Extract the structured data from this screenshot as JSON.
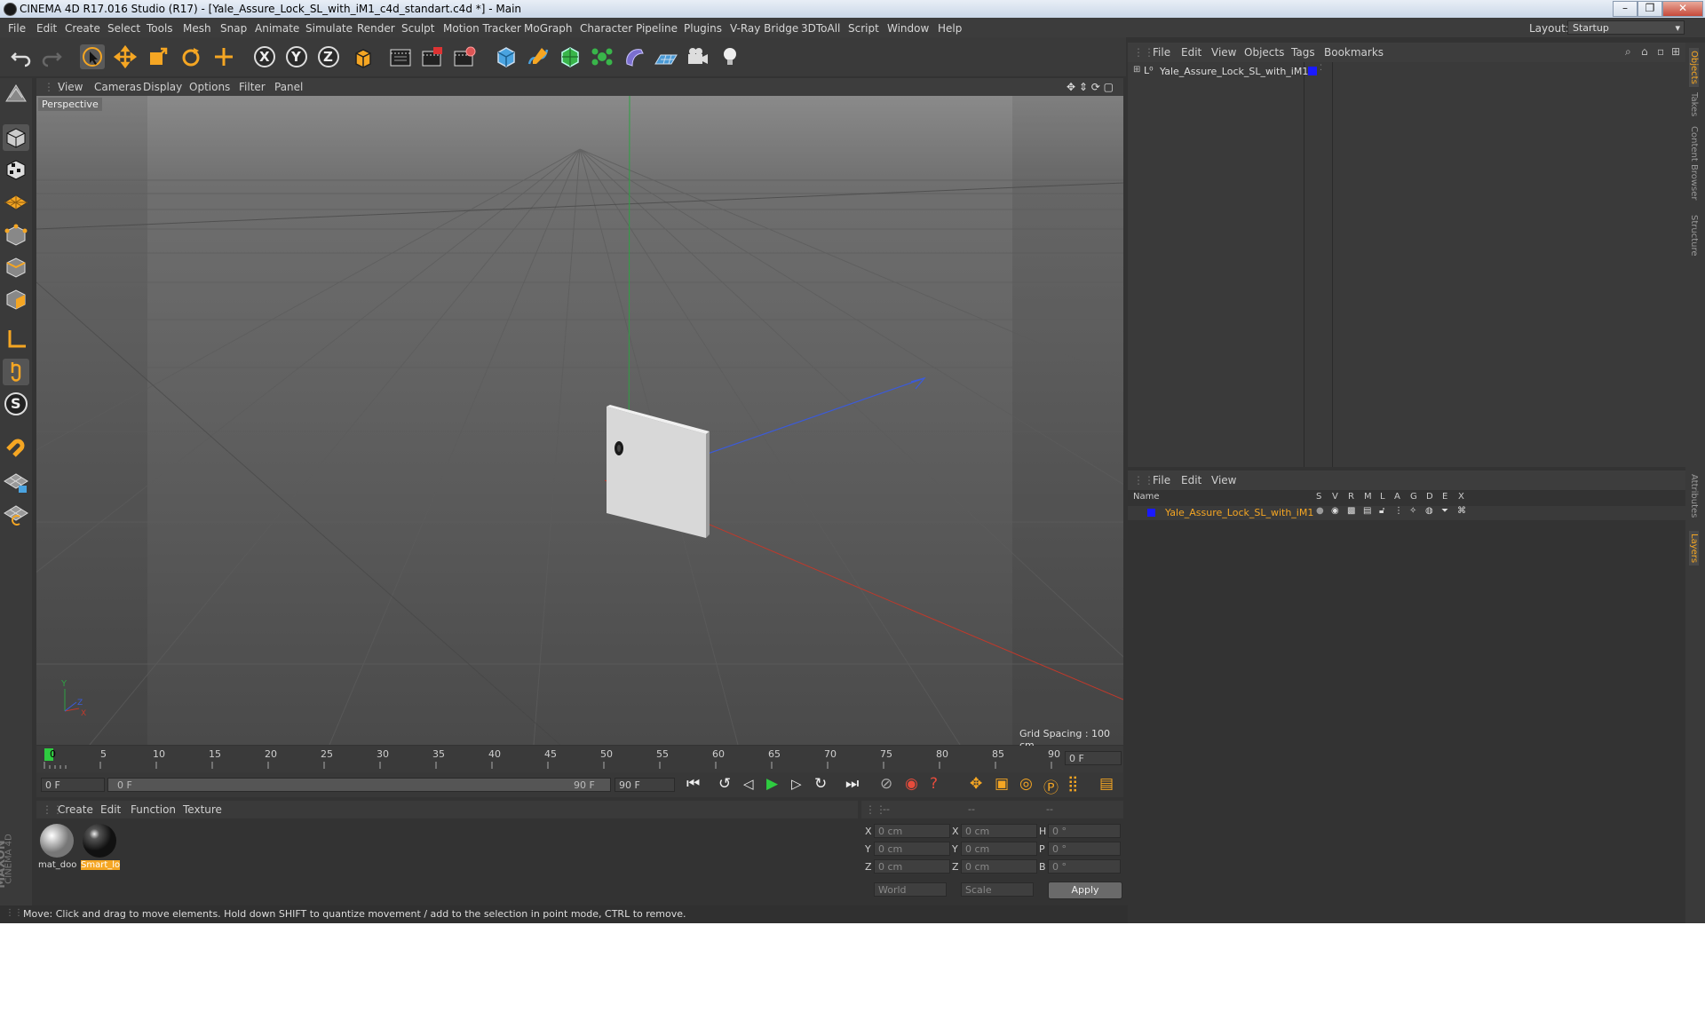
{
  "window": {
    "title": "CINEMA 4D R17.016 Studio (R17) - [Yale_Assure_Lock_SL_with_iM1_c4d_standart.c4d *] - Main",
    "controls": [
      "–",
      "❐",
      "✕"
    ]
  },
  "menubar": {
    "items": [
      "File",
      "Edit",
      "Create",
      "Select",
      "Tools",
      "Mesh",
      "Snap",
      "Animate",
      "Simulate",
      "Render",
      "Sculpt",
      "Motion Tracker",
      "MoGraph",
      "Character",
      "Pipeline",
      "Plugins",
      "V-Ray Bridge",
      "3DToAll",
      "Script",
      "Window",
      "Help"
    ],
    "layout_label": "Layout:",
    "layout_value": "Startup"
  },
  "toolbar": {
    "icons": [
      "undo-icon",
      "redo-icon",
      "live-selection-icon",
      "move-icon",
      "scale-icon",
      "rotate-icon",
      "recent-tools-icon",
      "x-axis-icon",
      "y-axis-icon",
      "z-axis-icon",
      "coordinate-system-icon",
      "render-view-icon",
      "render-picture-viewer-icon",
      "render-settings-icon",
      "cube-primitive-icon",
      "spline-pen-icon",
      "subdivision-surface-icon",
      "cloner-icon",
      "deformer-icon",
      "floor-icon",
      "camera-icon",
      "light-icon"
    ],
    "axis_labels": [
      "X",
      "Y",
      "Z"
    ]
  },
  "left_toolbar": {
    "icons": [
      "make-editable-icon",
      "model-mode-icon",
      "texture-mode-icon",
      "workplane-icon",
      "points-mode-icon",
      "edges-mode-icon",
      "polygons-mode-icon",
      "axis-mode-icon",
      "tweak-icon",
      "snap-s-icon",
      "magnet-icon",
      "workplane-lock-icon",
      "grid-snap-icon"
    ],
    "snap_label": "S"
  },
  "viewport": {
    "menu": [
      "View",
      "Cameras",
      "Display",
      "Options",
      "Filter",
      "Panel"
    ],
    "label": "Perspective",
    "grid_spacing": "Grid Spacing : 100 cm",
    "axis_labels": {
      "y": "Y",
      "z": "Z",
      "x": "X"
    }
  },
  "timeline": {
    "ticks": [
      "0",
      "5",
      "10",
      "15",
      "20",
      "25",
      "30",
      "35",
      "40",
      "45",
      "50",
      "55",
      "60",
      "65",
      "70",
      "75",
      "80",
      "85",
      "90"
    ],
    "current_frame": "0 F",
    "start_field": "0 F",
    "range_start": "0 F",
    "range_end": "90 F",
    "end_field": "90 F"
  },
  "materials": {
    "menu": [
      "Create",
      "Edit",
      "Function",
      "Texture"
    ],
    "items": [
      {
        "name": "mat_doo"
      },
      {
        "name": "Smart_lo"
      }
    ],
    "brand_top": "MAXON",
    "brand_bottom": "CINEMA 4D"
  },
  "coordinates": {
    "headers": [
      "--",
      "--",
      "--"
    ],
    "rows": [
      {
        "a": "X",
        "av": "0 cm",
        "b": "X",
        "bv": "0 cm",
        "c": "H",
        "cv": "0 °"
      },
      {
        "a": "Y",
        "av": "0 cm",
        "b": "Y",
        "bv": "0 cm",
        "c": "P",
        "cv": "0 °"
      },
      {
        "a": "Z",
        "av": "0 cm",
        "b": "Z",
        "bv": "0 cm",
        "c": "B",
        "cv": "0 °"
      }
    ],
    "mode1": "World",
    "mode2": "Scale",
    "apply": "Apply"
  },
  "object_manager": {
    "menu": [
      "File",
      "Edit",
      "View",
      "Objects",
      "Tags",
      "Bookmarks"
    ],
    "object_name": "Yale_Assure_Lock_SL_with_iM1",
    "layer_color": "#1a1aff"
  },
  "layer_manager": {
    "menu": [
      "File",
      "Edit",
      "View"
    ],
    "columns": [
      "Name",
      "S",
      "V",
      "R",
      "M",
      "L",
      "A",
      "G",
      "D",
      "E",
      "X"
    ],
    "layer_name": "Yale_Assure_Lock_SL_with_iM1",
    "layer_color": "#1a1aff"
  },
  "right_tabs": [
    "Objects",
    "Takes",
    "Content Browser",
    "Structure",
    "Attributes",
    "Layers"
  ],
  "statusbar": {
    "text": "Move: Click and drag to move elements. Hold down SHIFT to quantize movement / add to the selection in point mode, CTRL to remove."
  },
  "colors": {
    "accent": "#f5a623",
    "x_axis": "#c0392b",
    "y_axis": "#2ea043",
    "z_axis": "#3b5bdb"
  }
}
